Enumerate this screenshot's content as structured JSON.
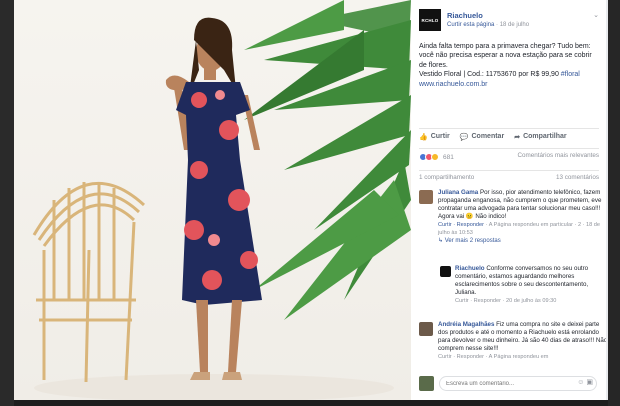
{
  "page": {
    "name": "Riachuelo",
    "logo_text": "RCHLO",
    "follow_label": "Curtir esta página",
    "date": "18 de julho"
  },
  "post": {
    "line1": "Ainda falta tempo para a primavera chegar? Tudo bem: você não precisa esperar a nova estação para se cobrir de flores.",
    "line2": "Vestido Floral | Cod.: 11753670 por R$ 99,90",
    "hashtag": "#floral",
    "link": "www.riachuelo.com.br"
  },
  "actions": {
    "like": "Curtir",
    "comment": "Comentar",
    "share": "Compartilhar"
  },
  "reactions": {
    "count": "681",
    "sort": "Comentários mais relevantes"
  },
  "shares": {
    "text": "1 compartilhamento",
    "comments": "13 comentários"
  },
  "comments": [
    {
      "name": "Juliana Gama",
      "text": "Por isso, pior atendimento telefônico, fazem propaganda enganosa, não cumprem o que prometem, eve contratar uma advogada para tentar solucionar meu caso!!! Agora vai",
      "emoji_tail": "Não indico!",
      "meta_reply": "Curtir · Responder",
      "meta_extra": "A Página respondeu em particular",
      "meta_likes": "2 · 18 de julho às 10:53",
      "more": "Ver mais 2 respostas"
    },
    {
      "name": "Riachuelo",
      "text": "Conforme conversamos no seu outro comentário, estamos aguardando melhores esclarecimentos sobre o seu descontentamento, Juliana.",
      "meta": "Curtir · Responder · 20 de julho às 09:30"
    },
    {
      "name": "Andréia Magalhães",
      "text": "Fiz uma compra no site e deixei parte dos produtos e até o momento a Riachuelo está enrolando para devolver o meu dinheiro. Já são 40 dias de atraso!!! Não comprem nesse site!!!",
      "meta": "Curtir · Responder · A Página respondeu em"
    }
  ],
  "comment_input": {
    "placeholder": "Escreva um comentário..."
  },
  "colors": {
    "brand": "#365899",
    "dress": "#1f2a5c",
    "floral": "#e2545b",
    "palm": "#3f8a3a"
  }
}
